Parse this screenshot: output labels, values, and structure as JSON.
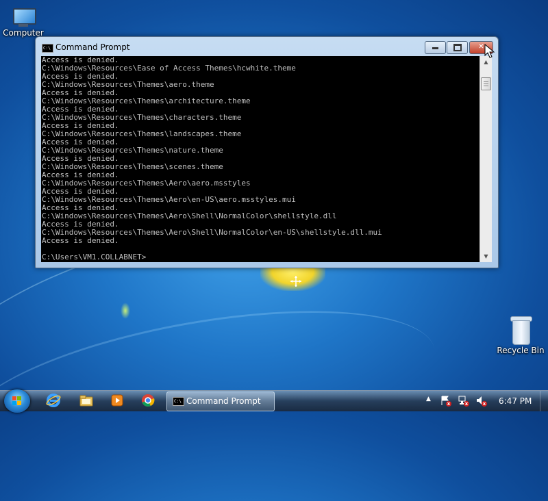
{
  "desktop": {
    "icons": [
      {
        "label": "Computer"
      },
      {
        "label": "Recycle Bin"
      }
    ]
  },
  "window": {
    "title": "Command Prompt",
    "icon_text": "C:\\",
    "controls": {
      "close_glyph": "✕"
    },
    "console_lines": [
      "Access is denied.",
      "C:\\Windows\\Resources\\Ease of Access Themes\\hcwhite.theme",
      "Access is denied.",
      "C:\\Windows\\Resources\\Themes\\aero.theme",
      "Access is denied.",
      "C:\\Windows\\Resources\\Themes\\architecture.theme",
      "Access is denied.",
      "C:\\Windows\\Resources\\Themes\\characters.theme",
      "Access is denied.",
      "C:\\Windows\\Resources\\Themes\\landscapes.theme",
      "Access is denied.",
      "C:\\Windows\\Resources\\Themes\\nature.theme",
      "Access is denied.",
      "C:\\Windows\\Resources\\Themes\\scenes.theme",
      "Access is denied.",
      "C:\\Windows\\Resources\\Themes\\Aero\\aero.msstyles",
      "Access is denied.",
      "C:\\Windows\\Resources\\Themes\\Aero\\en-US\\aero.msstyles.mui",
      "Access is denied.",
      "C:\\Windows\\Resources\\Themes\\Aero\\Shell\\NormalColor\\shellstyle.dll",
      "Access is denied.",
      "C:\\Windows\\Resources\\Themes\\Aero\\Shell\\NormalColor\\en-US\\shellstyle.dll.mui",
      "Access is denied.",
      "",
      "C:\\Users\\VM1.COLLABNET>"
    ]
  },
  "taskbar": {
    "pinned": [
      {
        "icon": "internet-explorer-icon"
      },
      {
        "icon": "windows-explorer-icon"
      },
      {
        "icon": "media-player-icon"
      },
      {
        "icon": "chrome-icon"
      }
    ],
    "active_task": {
      "label": "Command Prompt",
      "icon_text": "C:\\"
    },
    "tray": {
      "chevron": "▲",
      "clock": "6:47 PM"
    }
  },
  "colors": {
    "console_bg": "#000000",
    "console_fg": "#c0c0c0",
    "close_button": "#c2402a"
  }
}
